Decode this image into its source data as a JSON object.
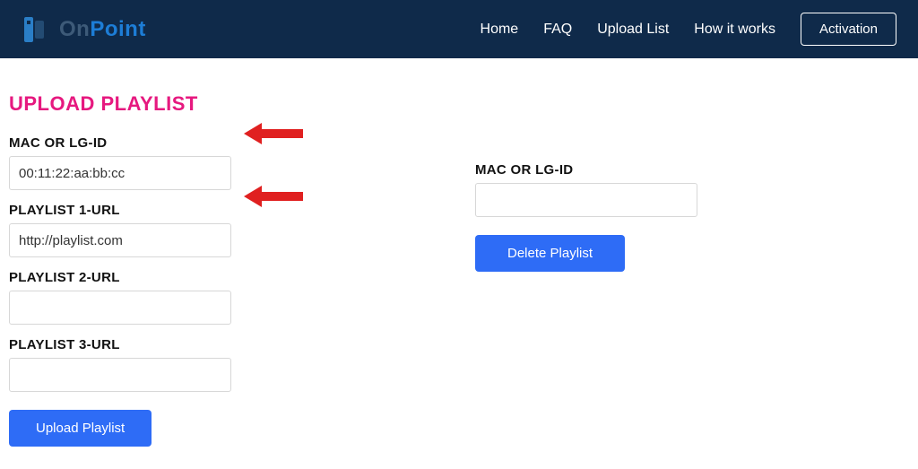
{
  "nav": {
    "logo": {
      "part1": "On",
      "part2": "Point"
    },
    "links": {
      "home": "Home",
      "faq": "FAQ",
      "upload_list": "Upload List",
      "how_it_works": "How it works"
    },
    "activation_label": "Activation"
  },
  "upload_section": {
    "title": "UPLOAD PLAYLIST",
    "mac_label": "MAC OR LG-ID",
    "mac_value": "00:11:22:aa:bb:cc",
    "playlist1_label": "PLAYLIST 1-URL",
    "playlist1_value": "http://playlist.com",
    "playlist2_label": "PLAYLIST 2-URL",
    "playlist2_value": "",
    "playlist3_label": "PLAYLIST 3-URL",
    "playlist3_value": "",
    "upload_button": "Upload Playlist"
  },
  "delete_section": {
    "mac_label": "MAC OR LG-ID",
    "mac_value": "",
    "delete_button": "Delete Playlist"
  },
  "colors": {
    "navbar_bg": "#0f2a4a",
    "accent_pink": "#e6197f",
    "btn_blue": "#2e6cf6",
    "arrow_red": "#e02020"
  }
}
